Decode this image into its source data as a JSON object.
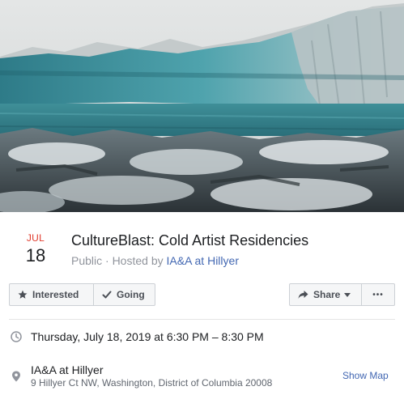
{
  "event": {
    "month": "JUL",
    "day": "18",
    "title": "CultureBlast: Cold Artist Residencies",
    "privacy": "Public · Hosted by ",
    "host": "IA&A at Hillyer"
  },
  "actions": {
    "interested_label": "Interested",
    "going_label": "Going",
    "share_label": "Share",
    "more_label": "•••"
  },
  "details": {
    "datetime": "Thursday, July 18, 2019 at 6:30 PM – 8:30 PM",
    "place_name": "IA&A at Hillyer",
    "place_address": "9 Hillyer Ct NW, Washington, District of Columbia 20008",
    "show_map_label": "Show Map"
  },
  "icons": {
    "interested": "star-icon",
    "going": "checkmark-icon",
    "share": "share-arrow-icon",
    "time": "clock-icon",
    "place": "map-pin-icon"
  },
  "colors": {
    "accent_red": "#e0392b",
    "link_blue": "#4267b2",
    "muted_text": "#90949c"
  }
}
